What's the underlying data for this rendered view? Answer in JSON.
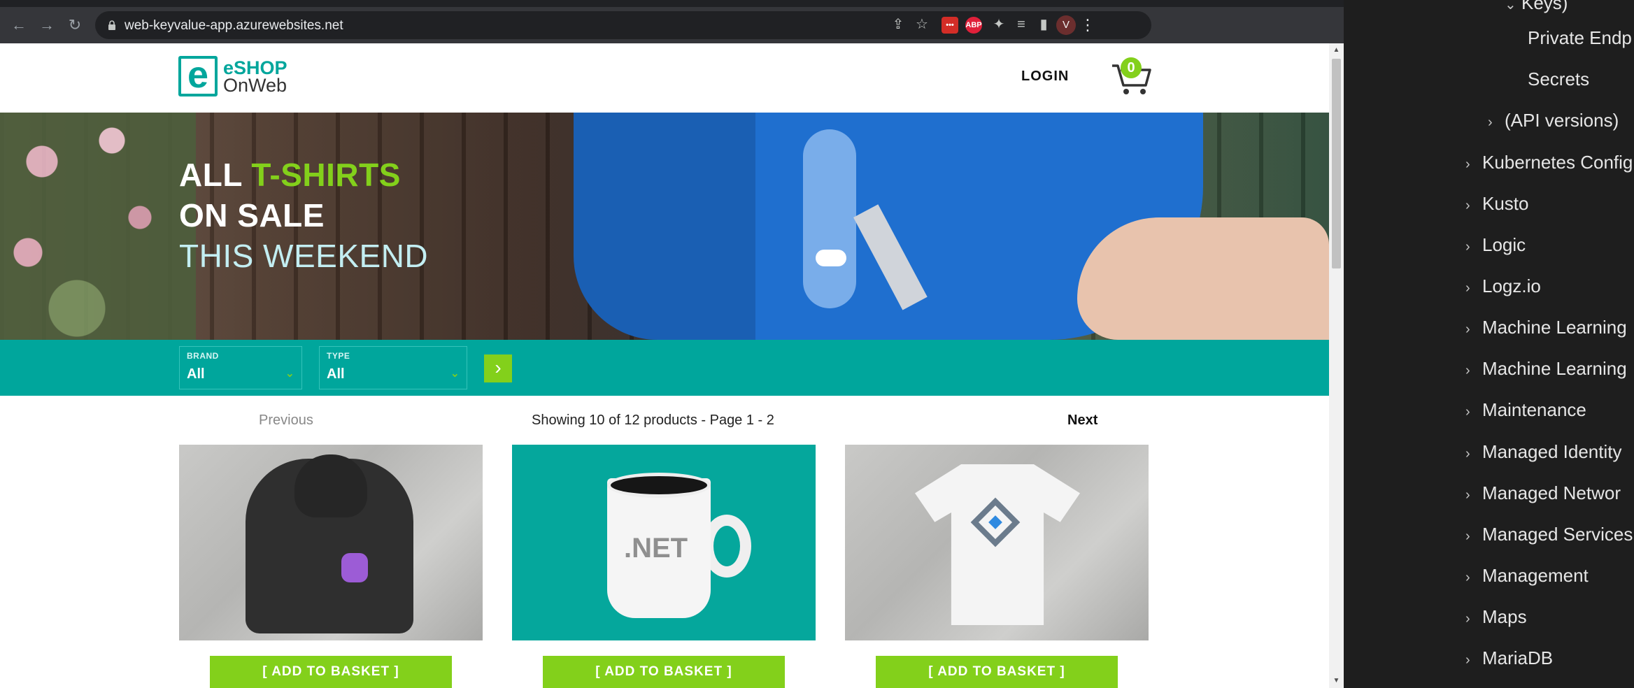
{
  "browser": {
    "url": "web-keyvalue-app.azurewebsites.net",
    "avatar_letter": "V",
    "extensions": [
      {
        "name": "lastpass-icon",
        "label": "•••",
        "color": "#d32d27"
      },
      {
        "name": "adblock-icon",
        "label": "ABP",
        "color": "#e0203a"
      }
    ]
  },
  "site": {
    "logo_line1": "eSHOP",
    "logo_line2": "OnWeb",
    "logo_letter": "e",
    "login_label": "LOGIN",
    "cart_count": "0"
  },
  "hero": {
    "line1_white": "ALL",
    "line1_green": "T-SHIRTS",
    "line2": "ON SALE",
    "line3": "THIS WEEKEND"
  },
  "filters": {
    "brand_label": "BRAND",
    "brand_value": "All",
    "type_label": "TYPE",
    "type_value": "All"
  },
  "pager": {
    "previous": "Previous",
    "showing": "Showing 10 of 12 products - Page 1 - 2",
    "next": "Next"
  },
  "products": [
    {
      "add_label": "[ ADD TO BASKET ]"
    },
    {
      "add_label": "[ ADD TO BASKET ]",
      "mug_text": ".NET"
    },
    {
      "add_label": "[ ADD TO BASKET ]"
    }
  ],
  "tree": {
    "items": [
      {
        "label": "Keys)",
        "chevron": "expanded"
      },
      {
        "label": "Private Endp",
        "chevron": "none"
      },
      {
        "label": "Secrets",
        "chevron": "none"
      },
      {
        "label": "(API versions)",
        "chevron": "collapsed"
      },
      {
        "label": "Kubernetes Config",
        "chevron": "collapsed"
      },
      {
        "label": "Kusto",
        "chevron": "collapsed"
      },
      {
        "label": "Logic",
        "chevron": "collapsed"
      },
      {
        "label": "Logz.io",
        "chevron": "collapsed"
      },
      {
        "label": "Machine Learning",
        "chevron": "collapsed"
      },
      {
        "label": "Machine Learning",
        "chevron": "collapsed"
      },
      {
        "label": "Maintenance",
        "chevron": "collapsed"
      },
      {
        "label": "Managed Identity",
        "chevron": "collapsed"
      },
      {
        "label": "Managed Networ",
        "chevron": "collapsed"
      },
      {
        "label": "Managed Services",
        "chevron": "collapsed"
      },
      {
        "label": "Management",
        "chevron": "collapsed"
      },
      {
        "label": "Maps",
        "chevron": "collapsed"
      },
      {
        "label": "MariaDB",
        "chevron": "collapsed"
      }
    ]
  }
}
